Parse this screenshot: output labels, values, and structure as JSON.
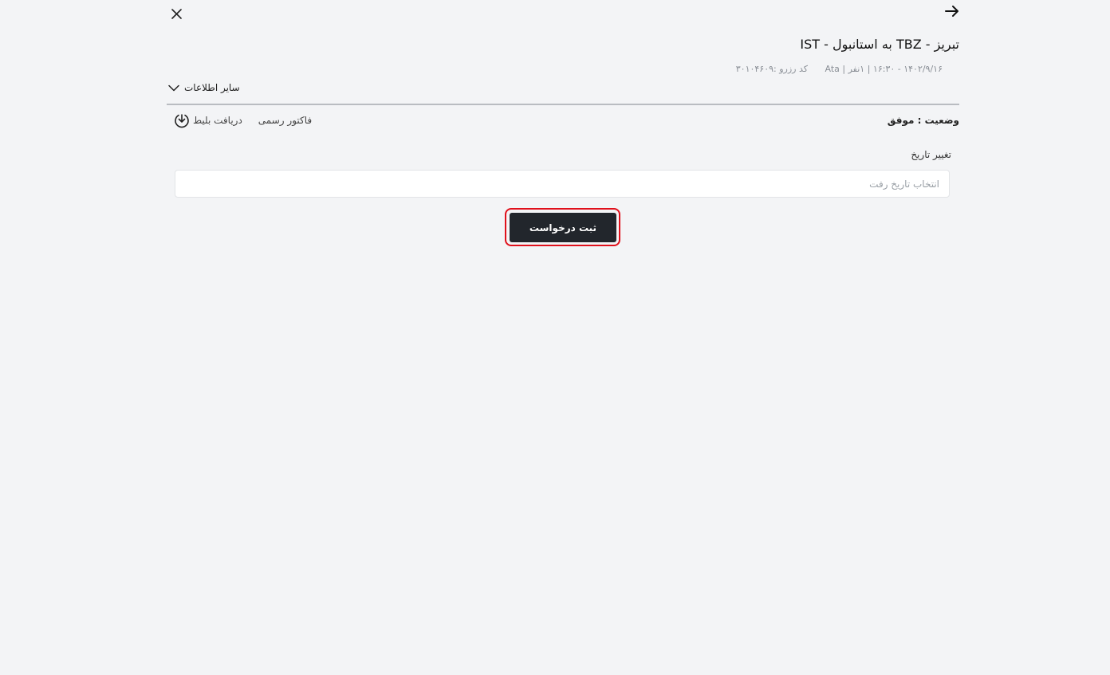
{
  "header": {
    "back_icon": "arrow-right-icon",
    "close_icon": "close-icon"
  },
  "trip": {
    "title": "تبریز - TBZ به استانبول - IST",
    "details": "۱۴۰۲/۹/۱۶ - ۱۶:۳۰ | ۱نفر | Ata",
    "booking_code": "کد رزرو :۳۰۱۰۴۶۰۹"
  },
  "more_info": {
    "label": "سایر اطلاعات",
    "icon": "chevron-down-icon"
  },
  "status": {
    "text": "وضعیت : موفق"
  },
  "actions": {
    "invoice_label": "فاکتور رسمی",
    "download_label": "دریافت بلیط",
    "download_icon": "download-icon"
  },
  "date_change": {
    "label": "تغییر تاریخ",
    "placeholder": "انتخاب تاریخ رفت"
  },
  "submit": {
    "label": "ثبت درخواست",
    "highlight_color": "#e0101b",
    "button_color": "#22262c"
  }
}
